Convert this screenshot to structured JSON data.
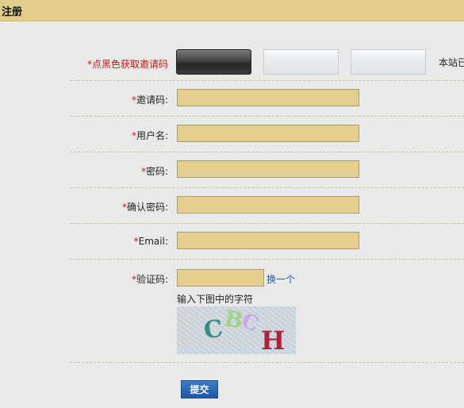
{
  "header": {
    "title": "注册"
  },
  "invite_row": {
    "label": "*点黑色获取邀请码",
    "note": "本站已"
  },
  "form": {
    "required_mark": "*",
    "invite_code_label": "邀请码:",
    "username_label": "用户名:",
    "password_label": "密码:",
    "confirm_password_label": "确认密码:",
    "email_label": "Email:",
    "captcha_label": "验证码:",
    "captcha_refresh": "换一个",
    "captcha_hint": "输入下图中的字符",
    "captcha_chars": [
      "C",
      "B",
      "C",
      "H"
    ]
  },
  "submit_label": "提交",
  "colors": {
    "titlebar": "#e2cc8a",
    "field_bg": "#e4cf8f",
    "required": "#d01818",
    "link": "#1d5ca6",
    "submit": "#1e56a3"
  }
}
